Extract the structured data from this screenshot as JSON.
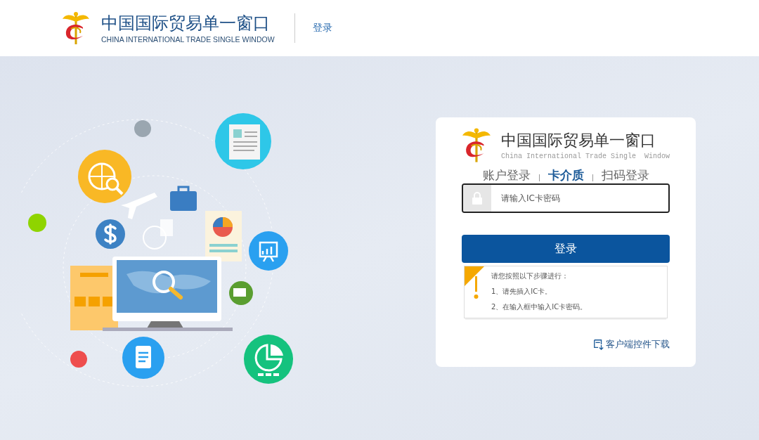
{
  "header": {
    "logo_title": "中国国际贸易单一窗口",
    "logo_subtitle": "CHINA INTERNATIONAL TRADE SINGLE WINDOW",
    "login_link": "登录"
  },
  "login_card": {
    "logo_title": "中国国际贸易单一窗口",
    "logo_subtitle": "China International Trade Single  Window",
    "tabs": [
      {
        "label": "账户登录",
        "selected": false
      },
      {
        "label": "卡介质",
        "selected": true
      },
      {
        "label": "扫码登录",
        "selected": false
      }
    ],
    "password_field": {
      "placeholder": "请输入IC卡密码"
    },
    "login_button": "登录",
    "notice": {
      "title": "请您按照以下步骤进行：",
      "steps": [
        "1、请先插入IC卡。",
        "2、在输入框中输入IC卡密码。"
      ]
    },
    "download_link": "客户端控件下载"
  }
}
